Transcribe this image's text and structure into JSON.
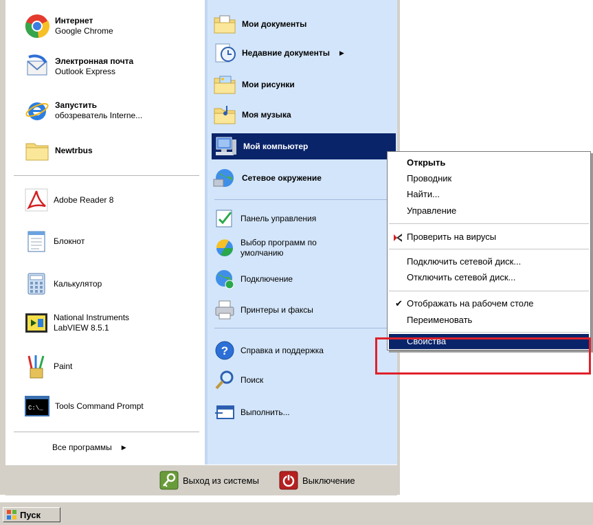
{
  "left_pinned": [
    {
      "title": "Интернет",
      "subtitle": "Google Chrome",
      "icon": "chrome-icon"
    },
    {
      "title": "Электронная почта",
      "subtitle": "Outlook Express",
      "icon": "outlook-icon"
    },
    {
      "title": "Запустить",
      "subtitle": "обозреватель Interne...",
      "icon": "ie-icon"
    },
    {
      "title": "Newtrbus",
      "icon": "folder-icon"
    }
  ],
  "left_recent": [
    {
      "label": "Adobe Reader 8",
      "icon": "adobe-reader-icon"
    },
    {
      "label": "Блокнот",
      "icon": "notepad-icon"
    },
    {
      "label": "Калькулятор",
      "icon": "calculator-icon"
    },
    {
      "label": "National Instruments",
      "label2": "LabVIEW 8.5.1",
      "icon": "labview-icon"
    },
    {
      "label": "Paint",
      "icon": "paint-icon"
    },
    {
      "label": "Tools Command Prompt",
      "icon": "command-prompt-icon"
    }
  ],
  "all_programs": "Все программы",
  "right_items": [
    {
      "label": "Мои документы",
      "bold": true,
      "icon": "my-documents-icon"
    },
    {
      "label": "Недавние документы",
      "bold": true,
      "icon": "recent-documents-icon",
      "submenu": true
    },
    {
      "label": "Мои рисунки",
      "bold": true,
      "icon": "my-pictures-icon"
    },
    {
      "label": "Моя музыка",
      "bold": true,
      "icon": "my-music-icon"
    },
    {
      "label": "Мой компьютер",
      "bold": true,
      "icon": "my-computer-icon",
      "highlight": true
    },
    {
      "label": "Сетевое окружение",
      "bold": true,
      "icon": "network-icon"
    },
    {
      "label": "Панель управления",
      "icon": "control-panel-icon"
    },
    {
      "label": "Выбор программ по",
      "label2": "умолчанию",
      "icon": "default-programs-icon"
    },
    {
      "label": "Подключение",
      "icon": "connect-icon"
    },
    {
      "label": "Принтеры и факсы",
      "icon": "printers-icon"
    },
    {
      "label": "Справка и поддержка",
      "icon": "help-icon"
    },
    {
      "label": "Поиск",
      "icon": "search-icon"
    },
    {
      "label": "Выполнить...",
      "icon": "run-icon"
    }
  ],
  "bottom": {
    "logoff": "Выход из системы",
    "shutdown": "Выключение"
  },
  "taskbar": {
    "start": "Пуск"
  },
  "context_menu": [
    {
      "label": "Открыть",
      "bold": true
    },
    {
      "label": "Проводник"
    },
    {
      "label": "Найти..."
    },
    {
      "label": "Управление"
    },
    {
      "label": "Проверить на вирусы",
      "icon": "antivirus-icon"
    },
    {
      "label": "Подключить сетевой диск..."
    },
    {
      "label": "Отключить сетевой диск..."
    },
    {
      "label": "Отображать на рабочем столе",
      "checked": true
    },
    {
      "label": "Переименовать"
    },
    {
      "label": "Свойства",
      "highlight": true
    }
  ],
  "colors": {
    "selection": "#0a246a",
    "annotation_frame": "#e0202a",
    "right_column": "#d3e5fa"
  }
}
